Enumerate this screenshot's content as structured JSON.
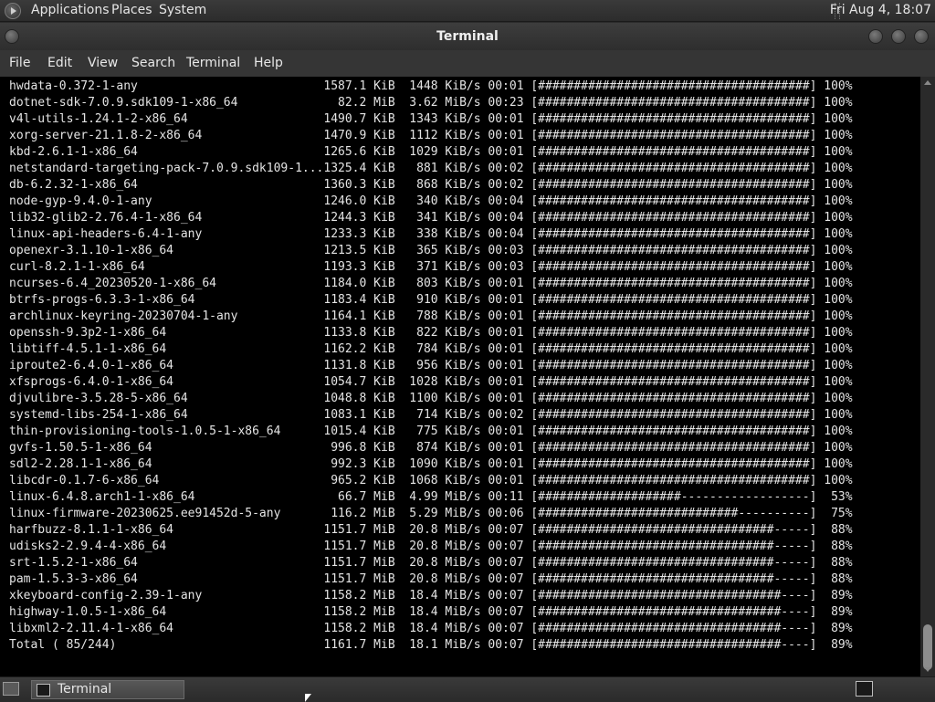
{
  "top_panel": {
    "menus": [
      "Applications",
      "Places",
      "System"
    ],
    "clock": "Fri Aug  4, 18:07"
  },
  "window": {
    "title": "Terminal"
  },
  "menubar": [
    "File",
    "Edit",
    "View",
    "Search",
    "Terminal",
    "Help"
  ],
  "terminal": {
    "lines": [
      "hwdata-0.372-1-any                          1587.1 KiB  1448 KiB/s 00:01 [######################################] 100%",
      "dotnet-sdk-7.0.9.sdk109-1-x86_64              82.2 MiB  3.62 MiB/s 00:23 [######################################] 100%",
      "v4l-utils-1.24.1-2-x86_64                   1490.7 KiB  1343 KiB/s 00:01 [######################################] 100%",
      "xorg-server-21.1.8-2-x86_64                 1470.9 KiB  1112 KiB/s 00:01 [######################################] 100%",
      "kbd-2.6.1-1-x86_64                          1265.6 KiB  1029 KiB/s 00:01 [######################################] 100%",
      "netstandard-targeting-pack-7.0.9.sdk109-1...1325.4 KiB   881 KiB/s 00:02 [######################################] 100%",
      "db-6.2.32-1-x86_64                          1360.3 KiB   868 KiB/s 00:02 [######################################] 100%",
      "node-gyp-9.4.0-1-any                        1246.0 KiB   340 KiB/s 00:04 [######################################] 100%",
      "lib32-glib2-2.76.4-1-x86_64                 1244.3 KiB   341 KiB/s 00:04 [######################################] 100%",
      "linux-api-headers-6.4-1-any                 1233.3 KiB   338 KiB/s 00:04 [######################################] 100%",
      "openexr-3.1.10-1-x86_64                     1213.5 KiB   365 KiB/s 00:03 [######################################] 100%",
      "curl-8.2.1-1-x86_64                         1193.3 KiB   371 KiB/s 00:03 [######################################] 100%",
      "ncurses-6.4_20230520-1-x86_64               1184.0 KiB   803 KiB/s 00:01 [######################################] 100%",
      "btrfs-progs-6.3.3-1-x86_64                  1183.4 KiB   910 KiB/s 00:01 [######################################] 100%",
      "archlinux-keyring-20230704-1-any            1164.1 KiB   788 KiB/s 00:01 [######################################] 100%",
      "openssh-9.3p2-1-x86_64                      1133.8 KiB   822 KiB/s 00:01 [######################################] 100%",
      "libtiff-4.5.1-1-x86_64                      1162.2 KiB   784 KiB/s 00:01 [######################################] 100%",
      "iproute2-6.4.0-1-x86_64                     1131.8 KiB   956 KiB/s 00:01 [######################################] 100%",
      "xfsprogs-6.4.0-1-x86_64                     1054.7 KiB  1028 KiB/s 00:01 [######################################] 100%",
      "djvulibre-3.5.28-5-x86_64                   1048.8 KiB  1100 KiB/s 00:01 [######################################] 100%",
      "systemd-libs-254-1-x86_64                   1083.1 KiB   714 KiB/s 00:02 [######################################] 100%",
      "thin-provisioning-tools-1.0.5-1-x86_64      1015.4 KiB   775 KiB/s 00:01 [######################################] 100%",
      "gvfs-1.50.5-1-x86_64                         996.8 KiB   874 KiB/s 00:01 [######################################] 100%",
      "sdl2-2.28.1-1-x86_64                         992.3 KiB  1090 KiB/s 00:01 [######################################] 100%",
      "libcdr-0.1.7-6-x86_64                        965.2 KiB  1068 KiB/s 00:01 [######################################] 100%",
      "linux-6.4.8.arch1-1-x86_64                    66.7 MiB  4.99 MiB/s 00:11 [####################------------------]  53%",
      "linux-firmware-20230625.ee91452d-5-any       116.2 MiB  5.29 MiB/s 00:06 [############################----------]  75%",
      "harfbuzz-8.1.1-1-x86_64                     1151.7 MiB  20.8 MiB/s 00:07 [#################################-----]  88%",
      "udisks2-2.9.4-4-x86_64                      1151.7 MiB  20.8 MiB/s 00:07 [#################################-----]  88%",
      "srt-1.5.2-1-x86_64                          1151.7 MiB  20.8 MiB/s 00:07 [#################################-----]  88%",
      "pam-1.5.3-3-x86_64                          1151.7 MiB  20.8 MiB/s 00:07 [#################################-----]  88%",
      "xkeyboard-config-2.39-1-any                 1158.2 MiB  18.4 MiB/s 00:07 [##################################----]  89%",
      "highway-1.0.5-1-x86_64                      1158.2 MiB  18.4 MiB/s 00:07 [##################################----]  89%",
      "libxml2-2.11.4-1-x86_64                     1158.2 MiB  18.4 MiB/s 00:07 [##################################----]  89%",
      "Total ( 85/244)                             1161.7 MiB  18.1 MiB/s 00:07 [##################################----]  89%"
    ]
  },
  "taskbar": {
    "task_label": "Terminal"
  }
}
